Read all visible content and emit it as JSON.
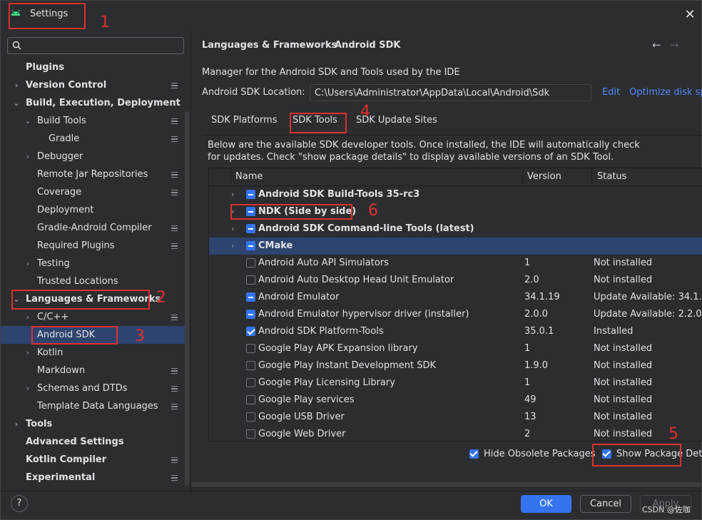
{
  "window": {
    "title": "Settings",
    "close_glyph": "✕"
  },
  "search": {
    "placeholder": "",
    "value": ""
  },
  "tree": {
    "items": [
      {
        "label": "Plugins",
        "bold": true
      },
      {
        "label": "Version Control",
        "bold": true,
        "chevron": "›",
        "pin": true
      },
      {
        "label": "Build, Execution, Deployment",
        "bold": true,
        "chevron": "⌄"
      },
      {
        "label": "Build Tools",
        "chevron": "⌄",
        "pin": true
      },
      {
        "label": "Gradle",
        "pin": true
      },
      {
        "label": "Debugger",
        "chevron": "›"
      },
      {
        "label": "Remote Jar Repositories",
        "pin": true
      },
      {
        "label": "Coverage",
        "pin": true
      },
      {
        "label": "Deployment"
      },
      {
        "label": "Gradle-Android Compiler",
        "pin": true
      },
      {
        "label": "Required Plugins",
        "pin": true
      },
      {
        "label": "Testing",
        "chevron": "›"
      },
      {
        "label": "Trusted Locations"
      },
      {
        "label": "Languages & Frameworks",
        "bold": true,
        "chevron": "⌄"
      },
      {
        "label": "C/C++",
        "chevron": "›",
        "pin": true
      },
      {
        "label": "Android SDK",
        "selected": true
      },
      {
        "label": "Kotlin",
        "chevron": "›"
      },
      {
        "label": "Markdown",
        "pin": true
      },
      {
        "label": "Schemas and DTDs",
        "chevron": "›",
        "pin": true
      },
      {
        "label": "Template Data Languages",
        "pin": true
      },
      {
        "label": "Tools",
        "bold": true,
        "chevron": "›"
      },
      {
        "label": "Advanced Settings",
        "bold": true
      },
      {
        "label": "Kotlin Compiler",
        "bold": true,
        "pin": true
      },
      {
        "label": "Experimental",
        "bold": true,
        "pin": true
      }
    ]
  },
  "breadcrumb": {
    "parent": "Languages & Frameworks",
    "separator": "›",
    "current": "Android SDK"
  },
  "nav": {
    "back": "←",
    "forward": "→"
  },
  "description": "Manager for the Android SDK and Tools used by the IDE",
  "sdk_location": {
    "label": "Android SDK Location:",
    "value": "C:\\Users\\Administrator\\AppData\\Local\\Android\\Sdk",
    "edit": "Edit",
    "optimize": "Optimize disk sp"
  },
  "tabs": [
    {
      "label": "SDK Platforms"
    },
    {
      "label": "SDK Tools",
      "active": true
    },
    {
      "label": "SDK Update Sites"
    }
  ],
  "info": {
    "line1": "Below are the available SDK developer tools. Once installed, the IDE will automatically check",
    "line2": "for updates. Check \"show package details\" to display available versions of an SDK Tool."
  },
  "table": {
    "headers": {
      "name": "Name",
      "version": "Version",
      "status": "Status"
    },
    "rows": [
      {
        "name": "Android SDK Build-Tools 35-rc3",
        "version": "",
        "status": "",
        "state": "partial",
        "expandable": true,
        "bold": true
      },
      {
        "name": "NDK (Side by side)",
        "version": "",
        "status": "",
        "state": "partial",
        "expandable": true,
        "bold": true
      },
      {
        "name": "Android SDK Command-line Tools (latest)",
        "version": "",
        "status": "",
        "state": "partial",
        "expandable": true,
        "bold": true
      },
      {
        "name": "CMake",
        "version": "",
        "status": "",
        "state": "partial",
        "expandable": true,
        "bold": true,
        "selected": true
      },
      {
        "name": "Android Auto API Simulators",
        "version": "1",
        "status": "Not installed",
        "state": "unchecked"
      },
      {
        "name": "Android Auto Desktop Head Unit Emulator",
        "version": "2.0",
        "status": "Not installed",
        "state": "unchecked"
      },
      {
        "name": "Android Emulator",
        "version": "34.1.19",
        "status": "Update Available: 34.1.",
        "state": "partial"
      },
      {
        "name": "Android Emulator hypervisor driver (installer)",
        "version": "2.0.0",
        "status": "Update Available: 2.2.0",
        "state": "partial"
      },
      {
        "name": "Android SDK Platform-Tools",
        "version": "35.0.1",
        "status": "Installed",
        "state": "checked"
      },
      {
        "name": "Google Play APK Expansion library",
        "version": "1",
        "status": "Not installed",
        "state": "unchecked"
      },
      {
        "name": "Google Play Instant Development SDK",
        "version": "1.9.0",
        "status": "Not installed",
        "state": "unchecked"
      },
      {
        "name": "Google Play Licensing Library",
        "version": "1",
        "status": "Not installed",
        "state": "unchecked"
      },
      {
        "name": "Google Play services",
        "version": "49",
        "status": "Not installed",
        "state": "unchecked"
      },
      {
        "name": "Google USB Driver",
        "version": "13",
        "status": "Not installed",
        "state": "unchecked"
      },
      {
        "name": "Google Web Driver",
        "version": "2",
        "status": "Not installed",
        "state": "unchecked"
      }
    ]
  },
  "options": {
    "hide_obsolete": "Hide Obsolete Packages",
    "show_details": "Show Package Deta"
  },
  "buttons": {
    "help": "?",
    "ok": "OK",
    "cancel": "Cancel",
    "apply": "Apply"
  },
  "watermark": "CSDN @佐咖",
  "annotations": [
    "1",
    "2",
    "3",
    "4",
    "5",
    "6"
  ],
  "colors": {
    "accent": "#3574f0",
    "annotation": "#e03030",
    "link": "#548af7",
    "selection": "#2e436e"
  }
}
